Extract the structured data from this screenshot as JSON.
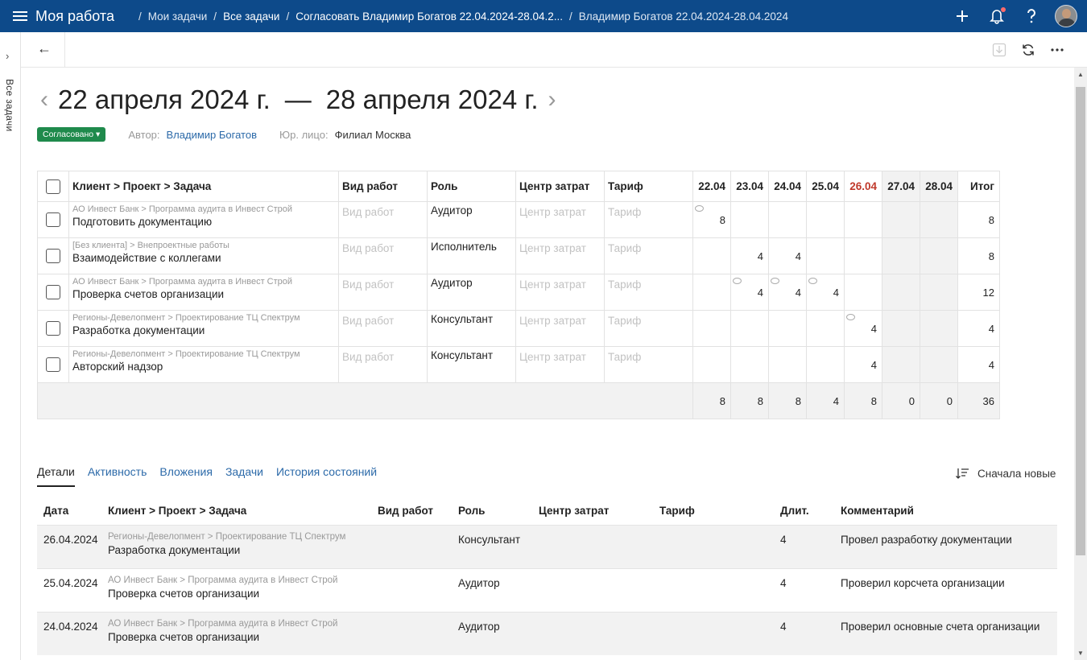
{
  "app": {
    "title": "Моя работа"
  },
  "breadcrumbs": [
    "Мои задачи",
    "Все задачи",
    "Согласовать Владимир Богатов 22.04.2024-28.04.2...",
    "Владимир Богатов 22.04.2024-28.04.2024"
  ],
  "rail": {
    "label": "Все задачи"
  },
  "period": {
    "start": "22 апреля 2024 г.",
    "dash": "—",
    "end": "28 апреля 2024 г."
  },
  "meta": {
    "status": "Согласовано",
    "author_label": "Автор:",
    "author": "Владимир Богатов",
    "entity_label": "Юр. лицо:",
    "entity": "Филиал Москва"
  },
  "grid": {
    "headers": {
      "task": "Клиент > Проект > Задача",
      "work": "Вид работ",
      "role": "Роль",
      "cost": "Центр затрат",
      "rate": "Тариф",
      "total": "Итог"
    },
    "days": [
      "22.04",
      "23.04",
      "24.04",
      "25.04",
      "26.04",
      "27.04",
      "28.04"
    ],
    "highlight_day_color": "#c0392b",
    "placeholders": {
      "work": "Вид работ",
      "cost": "Центр затрат",
      "rate": "Тариф"
    },
    "rows": [
      {
        "crumb": "АО Инвест Банк > Программа аудита в Инвест Строй",
        "task": "Подготовить документацию",
        "role": "Аудитор",
        "hours": [
          "8",
          "",
          "",
          "",
          "",
          "",
          ""
        ],
        "comments": [
          true,
          false,
          false,
          false,
          false,
          false,
          false
        ],
        "total": "8"
      },
      {
        "crumb": "[Без клиента] > Внепроектные работы",
        "task": "Взаимодействие с коллегами",
        "role": "Исполнитель",
        "hours": [
          "",
          "4",
          "4",
          "",
          "",
          "",
          ""
        ],
        "comments": [
          false,
          false,
          false,
          false,
          false,
          false,
          false
        ],
        "total": "8"
      },
      {
        "crumb": "АО Инвест Банк > Программа аудита в Инвест Строй",
        "task": "Проверка счетов организации",
        "role": "Аудитор",
        "hours": [
          "",
          "4",
          "4",
          "4",
          "",
          "",
          ""
        ],
        "comments": [
          false,
          true,
          true,
          true,
          false,
          false,
          false
        ],
        "total": "12"
      },
      {
        "crumb": "Регионы-Девелопмент > Проектирование ТЦ Спектрум",
        "task": "Разработка документации",
        "role": "Консультант",
        "hours": [
          "",
          "",
          "",
          "",
          "4",
          "",
          ""
        ],
        "comments": [
          false,
          false,
          false,
          false,
          true,
          false,
          false
        ],
        "total": "4"
      },
      {
        "crumb": "Регионы-Девелопмент > Проектирование ТЦ Спектрум",
        "task": "Авторский надзор",
        "role": "Консультант",
        "hours": [
          "",
          "",
          "",
          "",
          "4",
          "",
          ""
        ],
        "comments": [
          false,
          false,
          false,
          false,
          false,
          false,
          false
        ],
        "total": "4"
      }
    ],
    "sums": [
      "8",
      "8",
      "8",
      "4",
      "8",
      "0",
      "0"
    ],
    "grand_total": "36"
  },
  "tabs": [
    "Детали",
    "Активность",
    "Вложения",
    "Задачи",
    "История состояний"
  ],
  "sort": {
    "label": "Сначала новые"
  },
  "details": {
    "headers": [
      "Дата",
      "Клиент > Проект > Задача",
      "Вид работ",
      "Роль",
      "Центр затрат",
      "Тариф",
      "Длит.",
      "Комментарий"
    ],
    "rows": [
      {
        "date": "26.04.2024",
        "crumb": "Регионы-Девелопмент > Проектирование ТЦ Спектрум",
        "task": "Разработка документации",
        "work": "",
        "role": "Консультант",
        "cost": "",
        "rate": "",
        "dur": "4",
        "comment": "Провел разработку документации"
      },
      {
        "date": "25.04.2024",
        "crumb": "АО Инвест Банк > Программа аудита в Инвест Строй",
        "task": "Проверка счетов организации",
        "work": "",
        "role": "Аудитор",
        "cost": "",
        "rate": "",
        "dur": "4",
        "comment": "Проверил корсчета организации"
      },
      {
        "date": "24.04.2024",
        "crumb": "АО Инвест Банк > Программа аудита в Инвест Строй",
        "task": "Проверка счетов организации",
        "work": "",
        "role": "Аудитор",
        "cost": "",
        "rate": "",
        "dur": "4",
        "comment": "Проверил основные счета организации"
      }
    ]
  },
  "colors": {
    "topbar": "#0d4a8a",
    "status_green": "#1f8a4c",
    "link": "#2c6aa9"
  },
  "icons": [
    "menu-icon",
    "plus-icon",
    "bell-icon",
    "help-icon",
    "back-arrow-icon",
    "download-icon",
    "refresh-icon",
    "more-icon",
    "sort-icon",
    "comment-icon",
    "chevron-right-icon"
  ]
}
